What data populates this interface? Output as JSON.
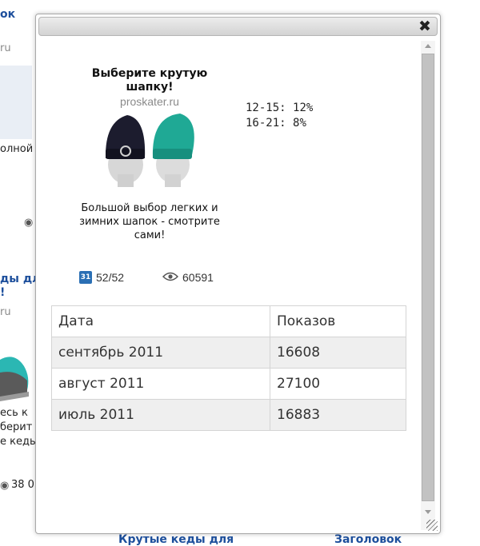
{
  "background": {
    "left_fragments": [
      {
        "name": "bg-link-top",
        "text": "ок",
        "style": "link"
      },
      {
        "name": "bg-domain-1",
        "text": "ru",
        "style": "gray"
      },
      {
        "name": "bg-text-1",
        "text": "олной",
        "style": "dark"
      },
      {
        "name": "bg-link-2a",
        "text": "ды дл",
        "style": "link"
      },
      {
        "name": "bg-link-2b",
        "text": "!",
        "style": "link"
      },
      {
        "name": "bg-domain-2",
        "text": "ru",
        "style": "gray"
      },
      {
        "name": "bg-text-2a",
        "text": "есь к",
        "style": "dark"
      },
      {
        "name": "bg-text-2b",
        "text": "берит",
        "style": "dark"
      },
      {
        "name": "bg-text-2c",
        "text": "е кеды",
        "style": "dark"
      },
      {
        "name": "bg-views-2",
        "text": "38 0",
        "style": "dark"
      }
    ],
    "bottom_links": [
      "Крутые кеды для",
      "Заголовок"
    ]
  },
  "dialog": {
    "close_label": "✖"
  },
  "ad": {
    "title": "Выберите крутую шапку!",
    "domain": "proskater.ru",
    "description": "Большой выбор легких и зимних шапок - смотрите сами!",
    "image_icon": "beanie-hats-image",
    "calendar_icon_text": "31",
    "days": "52/52",
    "views": "60591"
  },
  "age_stats": [
    {
      "label": "12-15:",
      "value": "12%"
    },
    {
      "label": "16-21:",
      "value": "8%"
    }
  ],
  "table": {
    "headers": [
      "Дата",
      "Показов"
    ],
    "rows": [
      [
        "сентябрь 2011",
        "16608"
      ],
      [
        "август 2011",
        "27100"
      ],
      [
        "июль 2011",
        "16883"
      ]
    ]
  }
}
